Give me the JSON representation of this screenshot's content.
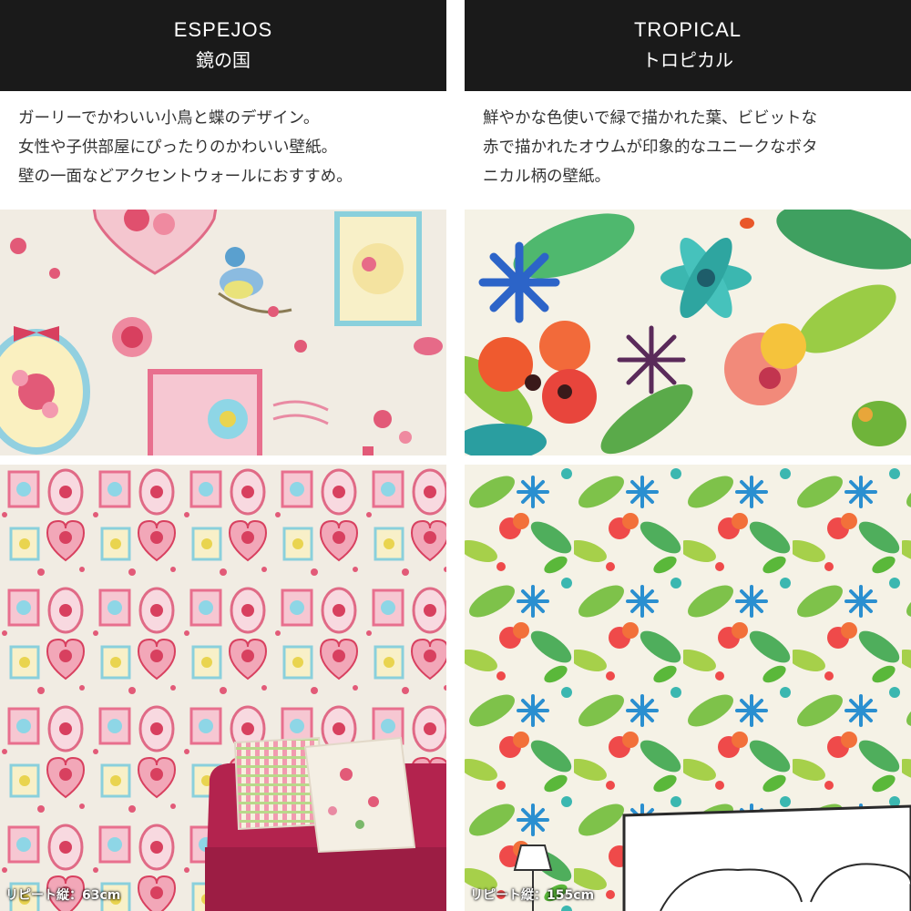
{
  "colors": {
    "header_bg": "#1a1a1a",
    "espejos_bg": "#f1ece3",
    "tropical_bg": "#f5f2e6",
    "sofa": "#b3234e"
  },
  "espejos": {
    "title_en": "ESPEJOS",
    "title_jp": "鏡の国",
    "description": [
      "ガーリーでかわいい小鳥と蝶のデザイン。",
      "女性や子供部屋にぴったりのかわいい壁紙。",
      "壁の一面などアクセントウォールにおすすめ。"
    ],
    "repeat_label": "リピート縦：63cm"
  },
  "tropical": {
    "title_en": "TROPICAL",
    "title_jp": "トロピカル",
    "description": [
      "鮮やかな色使いで緑で描かれた葉、ビビットな",
      "赤で描かれたオウムが印象的なユニークなボタ",
      "ニカル柄の壁紙。"
    ],
    "repeat_label": "リピート縦：155cm"
  }
}
